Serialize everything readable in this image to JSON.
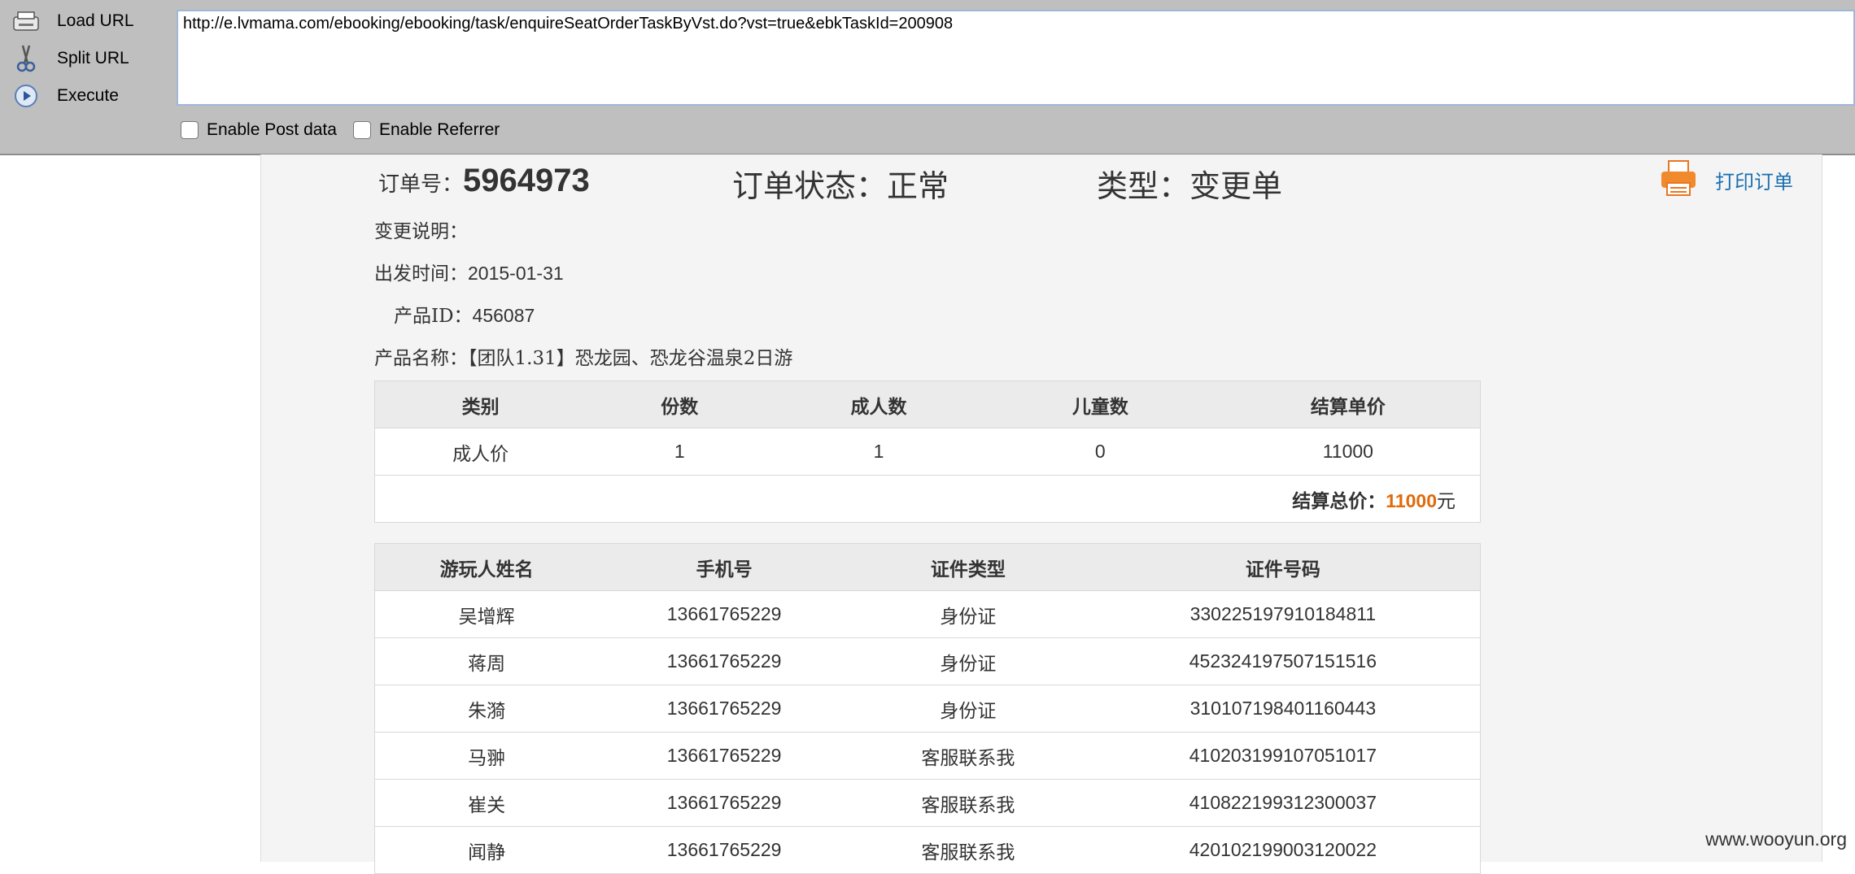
{
  "hackbar": {
    "load_url": "Load URL",
    "split_url": "Split URL",
    "execute": "Execute",
    "url_value": "http://e.lvmama.com/ebooking/ebooking/task/enquireSeatOrderTaskByVst.do?vst=true&ebkTaskId=200908",
    "enable_post": "Enable Post data",
    "enable_referrer": "Enable Referrer"
  },
  "order": {
    "number_label": "订单号：",
    "number": "5964973",
    "status": "订单状态：正常",
    "type": "类型：变更单",
    "print_label": "打印订单",
    "change_note_label": "变更说明：",
    "depart_label": "出发时间：",
    "depart_value": "2015-01-31",
    "product_id_label": "产品ID：",
    "product_id_value": "456087",
    "product_name_label": "产品名称：",
    "product_name_value": "【团队1.31】恐龙园、恐龙谷温泉2日游"
  },
  "price_table": {
    "headers": [
      "类别",
      "份数",
      "成人数",
      "儿童数",
      "结算单价"
    ],
    "row": [
      "成人价",
      "1",
      "1",
      "0",
      "11000"
    ],
    "total_label": "结算总价：",
    "total_value": "11000",
    "total_unit": "元"
  },
  "guest_table": {
    "headers": [
      "游玩人姓名",
      "手机号",
      "证件类型",
      "证件号码"
    ],
    "rows": [
      [
        "吴增辉",
        "13661765229",
        "身份证",
        "330225197910184811"
      ],
      [
        "蒋周",
        "13661765229",
        "身份证",
        "452324197507151516"
      ],
      [
        "朱漪",
        "13661765229",
        "身份证",
        "310107198401160443"
      ],
      [
        "马翀",
        "13661765229",
        "客服联系我",
        "410203199107051017"
      ],
      [
        "崔关",
        "13661765229",
        "客服联系我",
        "410822199312300037"
      ],
      [
        "闻静",
        "13661765229",
        "客服联系我",
        "420102199003120022"
      ]
    ]
  },
  "watermark": "www.wooyun.org",
  "colors": {
    "accent_orange": "#e06a0c",
    "link_blue": "#1a6fb0",
    "toolbar_gray": "#bfbfbf"
  }
}
